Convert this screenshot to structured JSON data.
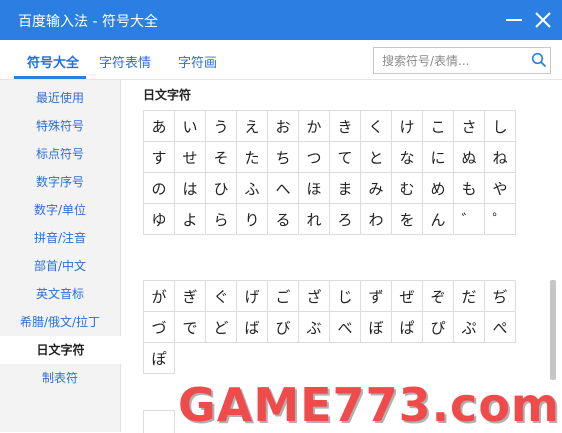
{
  "window": {
    "title": "百度输入法 - 符号大全"
  },
  "tabs": [
    {
      "label": "符号大全",
      "active": true
    },
    {
      "label": "字符表情",
      "active": false
    },
    {
      "label": "字符画",
      "active": false
    }
  ],
  "search": {
    "placeholder": "搜索符号/表情..."
  },
  "sidebar": {
    "items": [
      {
        "label": "最近使用"
      },
      {
        "label": "特殊符号"
      },
      {
        "label": "标点符号"
      },
      {
        "label": "数字序号"
      },
      {
        "label": "数字/单位"
      },
      {
        "label": "拼音/注音"
      },
      {
        "label": "部首/中文"
      },
      {
        "label": "英文音标"
      },
      {
        "label": "希腊/俄文/拉丁"
      },
      {
        "label": "日文字符"
      },
      {
        "label": "制表符"
      }
    ],
    "active_label": "日文字符"
  },
  "section": {
    "title": "日文字符"
  },
  "grid1": [
    [
      "あ",
      "い",
      "う",
      "え",
      "お",
      "か",
      "き",
      "く",
      "け",
      "こ",
      "さ",
      "し"
    ],
    [
      "す",
      "せ",
      "そ",
      "た",
      "ち",
      "つ",
      "て",
      "と",
      "な",
      "に",
      "ぬ",
      "ね"
    ],
    [
      "の",
      "は",
      "ひ",
      "ふ",
      "へ",
      "ほ",
      "ま",
      "み",
      "む",
      "め",
      "も",
      "や"
    ],
    [
      "ゆ",
      "よ",
      "ら",
      "り",
      "る",
      "れ",
      "ろ",
      "わ",
      "を",
      "ん",
      "゛",
      "゜"
    ]
  ],
  "grid2": [
    [
      "が",
      "ぎ",
      "ぐ",
      "げ",
      "ご",
      "ざ",
      "じ",
      "ず",
      "ぜ",
      "ぞ",
      "だ",
      "ぢ"
    ],
    [
      "づ",
      "で",
      "ど",
      "ば",
      "び",
      "ぶ",
      "べ",
      "ぼ",
      "ぱ",
      "ぴ",
      "ぷ",
      "ぺ"
    ],
    [
      "ぽ"
    ]
  ],
  "watermark": {
    "text": "GAME773.com"
  },
  "colors": {
    "titlebar": "#2b7fe2",
    "accent": "#1f6fe0",
    "sidebar_bg": "#f3f3f3",
    "watermark": "#f04a4a"
  },
  "icons": {
    "minimize": "minimize-icon",
    "close": "close-icon",
    "search": "search-icon"
  }
}
